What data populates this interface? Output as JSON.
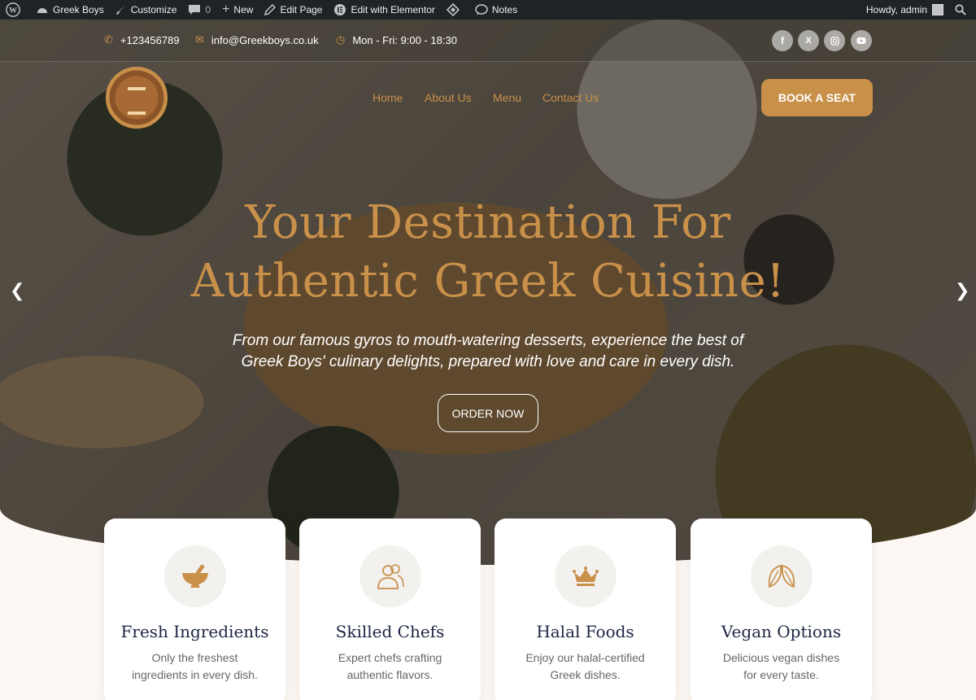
{
  "adminbar": {
    "site_name": "Greek Boys",
    "customize": "Customize",
    "comments_count": "0",
    "new_label": "New",
    "edit_page": "Edit Page",
    "edit_elementor": "Edit with Elementor",
    "notes": "Notes",
    "howdy": "Howdy, admin"
  },
  "topbar": {
    "phone": "+123456789",
    "email": "info@Greekboys.co.uk",
    "hours": "Mon - Fri: 9:00 - 18:30",
    "socials": [
      "facebook-icon",
      "x-icon",
      "instagram-icon",
      "youtube-icon"
    ]
  },
  "nav": {
    "items": [
      "Home",
      "About Us",
      "Menu",
      "Contact Us"
    ],
    "book_label": "BOOK A SEAT"
  },
  "hero": {
    "headline_1": "Your Destination For",
    "headline_2": "Authentic Greek Cuisine!",
    "sub_1": "From our famous gyros to mouth-watering desserts, experience the best of",
    "sub_2": "Greek Boys' culinary delights, prepared with love and care in every dish.",
    "order_label": "ORDER NOW"
  },
  "features": [
    {
      "title": "Fresh Ingredients",
      "line_1": "Only the freshest",
      "line_2": "ingredients in every dish.",
      "icon": "mortar-icon"
    },
    {
      "title": "Skilled Chefs",
      "line_1": "Expert chefs crafting",
      "line_2": "authentic flavors.",
      "icon": "chefs-icon"
    },
    {
      "title": "Halal Foods",
      "line_1": "Enjoy our halal-certified",
      "line_2": "Greek dishes.",
      "icon": "crown-icon"
    },
    {
      "title": "Vegan Options",
      "line_1": "Delicious vegan dishes",
      "line_2": "for every taste.",
      "icon": "leaves-icon"
    }
  ],
  "colors": {
    "accent": "#c9904a",
    "navy": "#1c2543",
    "adminbar": "#1d2327"
  }
}
